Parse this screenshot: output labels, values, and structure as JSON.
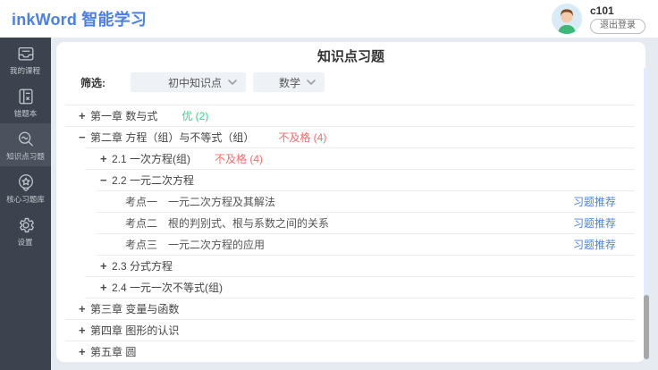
{
  "header": {
    "logo": "inkWord 智能学习",
    "username": "c101",
    "logout_label": "退出登录"
  },
  "sidebar": {
    "items": [
      {
        "label": "我的课程",
        "icon": "courses-icon",
        "active": false
      },
      {
        "label": "错题本",
        "icon": "wrong-book-icon",
        "active": false
      },
      {
        "label": "知识点习题",
        "icon": "knowledge-search-icon",
        "active": true
      },
      {
        "label": "核心习题库",
        "icon": "core-library-icon",
        "active": false
      },
      {
        "label": "设置",
        "icon": "settings-icon",
        "active": false
      }
    ]
  },
  "main": {
    "title": "知识点习题",
    "filter": {
      "label": "筛选:",
      "dropdowns": [
        {
          "value": "初中知识点"
        },
        {
          "value": "数学"
        }
      ]
    },
    "tree": [
      {
        "level": 1,
        "expander": "+",
        "text": "第一章 数与式",
        "status": "优 (2)",
        "status_type": "good"
      },
      {
        "level": 1,
        "expander": "−",
        "text": "第二章 方程（组）与不等式（组）",
        "status": "不及格 (4)",
        "status_type": "bad"
      },
      {
        "level": 2,
        "expander": "+",
        "text": "2.1 一次方程(组)",
        "status": "不及格 (4)",
        "status_type": "bad"
      },
      {
        "level": 2,
        "expander": "−",
        "text": "2.2 一元二次方程"
      },
      {
        "level": 3,
        "text": "考点一　一元二次方程及其解法",
        "link": "习题推荐"
      },
      {
        "level": 3,
        "text": "考点二　根的判别式、根与系数之间的关系",
        "link": "习题推荐"
      },
      {
        "level": 3,
        "text": "考点三　一元二次方程的应用",
        "link": "习题推荐"
      },
      {
        "level": 2,
        "expander": "+",
        "text": "2.3 分式方程"
      },
      {
        "level": 2,
        "expander": "+",
        "text": "2.4 一元一次不等式(组)"
      },
      {
        "level": 1,
        "expander": "+",
        "text": "第三章 变量与函数"
      },
      {
        "level": 1,
        "expander": "+",
        "text": "第四章 图形的认识"
      },
      {
        "level": 1,
        "expander": "+",
        "text": "第五章 圆"
      }
    ]
  },
  "colors": {
    "brand_blue": "#4a7fe8",
    "link_blue": "#4f86d8",
    "status_good_green": "#3ecf8e",
    "status_bad_red": "#f56c6c",
    "sidebar_bg": "#3d434e",
    "sidebar_active_bg": "#4b515d",
    "content_bg": "#e6eaf1"
  }
}
